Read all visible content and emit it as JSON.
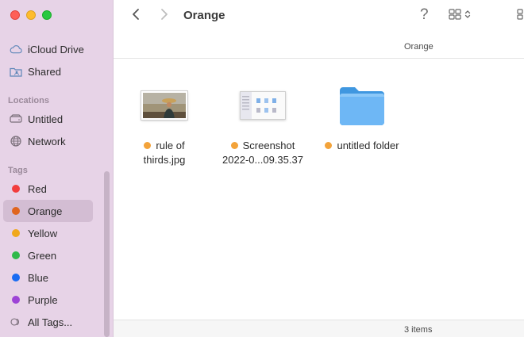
{
  "window": {
    "title": "Orange"
  },
  "sidebar": {
    "favorites": [
      {
        "label": "iCloud Drive",
        "icon": "cloud-icon"
      },
      {
        "label": "Shared",
        "icon": "shared-folder-icon"
      }
    ],
    "locations_heading": "Locations",
    "locations": [
      {
        "label": "Untitled",
        "icon": "disk-icon"
      },
      {
        "label": "Network",
        "icon": "globe-icon"
      }
    ],
    "tags_heading": "Tags",
    "tags": [
      {
        "label": "Red",
        "color": "#f23d3d"
      },
      {
        "label": "Orange",
        "color": "#e0651e",
        "selected": true
      },
      {
        "label": "Yellow",
        "color": "#f0a81c"
      },
      {
        "label": "Green",
        "color": "#2fb94a"
      },
      {
        "label": "Blue",
        "color": "#1a6cf2"
      },
      {
        "label": "Purple",
        "color": "#9d44d6"
      }
    ],
    "all_tags_label": "All Tags..."
  },
  "path": {
    "current": "Orange"
  },
  "files": [
    {
      "name_line1": "rule of",
      "name_line2": "thirds.jpg",
      "tag_color": "#f3a33a",
      "icon": "image-thumbnail-icon"
    },
    {
      "name_line1": "Screenshot",
      "name_line2": "2022-0...09.35.37",
      "tag_color": "#f3a33a",
      "icon": "screenshot-thumbnail-icon"
    },
    {
      "name_line1": "untitled folder",
      "name_line2": "",
      "tag_color": "#f3a33a",
      "icon": "folder-icon"
    }
  ],
  "status": {
    "item_count": "3 items"
  }
}
